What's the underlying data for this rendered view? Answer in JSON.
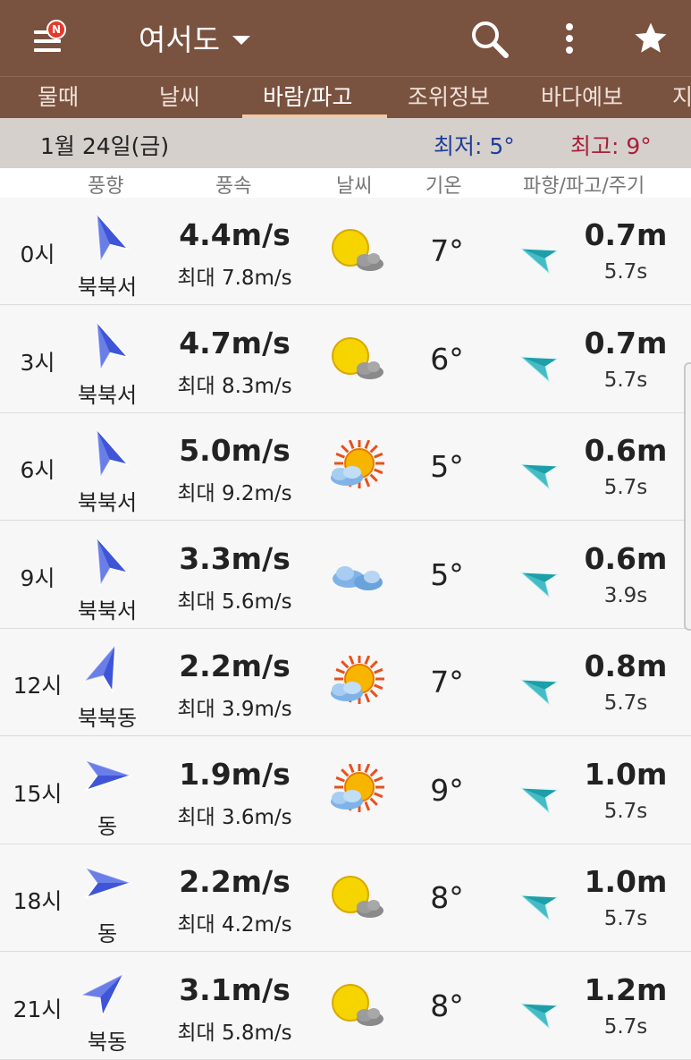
{
  "header": {
    "menu_badge": "N",
    "location": "여서도"
  },
  "tabs": [
    "물때",
    "날씨",
    "바람/파고",
    "조위정보",
    "바다예보",
    "지"
  ],
  "active_tab": 2,
  "date_bar": {
    "date": "1월 24일(금)",
    "low": "최저: 5°",
    "high": "최고: 9°",
    "low_color": "#1f3f9a",
    "high_color": "#a82038"
  },
  "columns": {
    "wind_dir": "풍향",
    "wind_speed": "풍속",
    "weather": "날씨",
    "temp": "기온",
    "wave": "파향/파고/주기"
  },
  "rows": [
    {
      "hour": "0시",
      "dir_label": "북북서",
      "dir_deg": 337,
      "speed": "4.4m/s",
      "max": "최대 7.8m/s",
      "wx_icon": "sun-behind-cloud-icon",
      "wx": "sun-cloud",
      "temp": "7°",
      "wave_deg": 292,
      "wave_h": "0.7m",
      "wave_p": "5.7s"
    },
    {
      "hour": "3시",
      "dir_label": "북북서",
      "dir_deg": 337,
      "speed": "4.7m/s",
      "max": "최대 8.3m/s",
      "wx_icon": "sun-behind-cloud-icon",
      "wx": "sun-cloud",
      "temp": "6°",
      "wave_deg": 292,
      "wave_h": "0.7m",
      "wave_p": "5.7s"
    },
    {
      "hour": "6시",
      "dir_label": "북북서",
      "dir_deg": 337,
      "speed": "5.0m/s",
      "max": "최대 9.2m/s",
      "wx_icon": "sun-partly-cloudy-icon",
      "wx": "sun-rays",
      "temp": "5°",
      "wave_deg": 292,
      "wave_h": "0.6m",
      "wave_p": "5.7s"
    },
    {
      "hour": "9시",
      "dir_label": "북북서",
      "dir_deg": 337,
      "speed": "3.3m/s",
      "max": "최대 5.6m/s",
      "wx_icon": "cloudy-icon",
      "wx": "clouds",
      "temp": "5°",
      "wave_deg": 292,
      "wave_h": "0.6m",
      "wave_p": "3.9s"
    },
    {
      "hour": "12시",
      "dir_label": "북북동",
      "dir_deg": 22,
      "speed": "2.2m/s",
      "max": "최대 3.9m/s",
      "wx_icon": "sun-partly-cloudy-icon",
      "wx": "sun-rays",
      "temp": "7°",
      "wave_deg": 292,
      "wave_h": "0.8m",
      "wave_p": "5.7s"
    },
    {
      "hour": "15시",
      "dir_label": "동",
      "dir_deg": 90,
      "speed": "1.9m/s",
      "max": "최대 3.6m/s",
      "wx_icon": "sun-partly-cloudy-icon",
      "wx": "sun-rays",
      "temp": "9°",
      "wave_deg": 292,
      "wave_h": "1.0m",
      "wave_p": "5.7s"
    },
    {
      "hour": "18시",
      "dir_label": "동",
      "dir_deg": 90,
      "speed": "2.2m/s",
      "max": "최대 4.2m/s",
      "wx_icon": "sun-behind-cloud-icon",
      "wx": "sun-cloud",
      "temp": "8°",
      "wave_deg": 292,
      "wave_h": "1.0m",
      "wave_p": "5.7s"
    },
    {
      "hour": "21시",
      "dir_label": "북동",
      "dir_deg": 45,
      "speed": "3.1m/s",
      "max": "최대 5.8m/s",
      "wx_icon": "sun-behind-cloud-icon",
      "wx": "sun-cloud",
      "temp": "8°",
      "wave_deg": 292,
      "wave_h": "1.2m",
      "wave_p": "5.7s"
    }
  ],
  "colors": {
    "appbar": "#7a5240",
    "wind_arrow": "#3f55d8",
    "wave_arrow": "#1e9ea8"
  }
}
